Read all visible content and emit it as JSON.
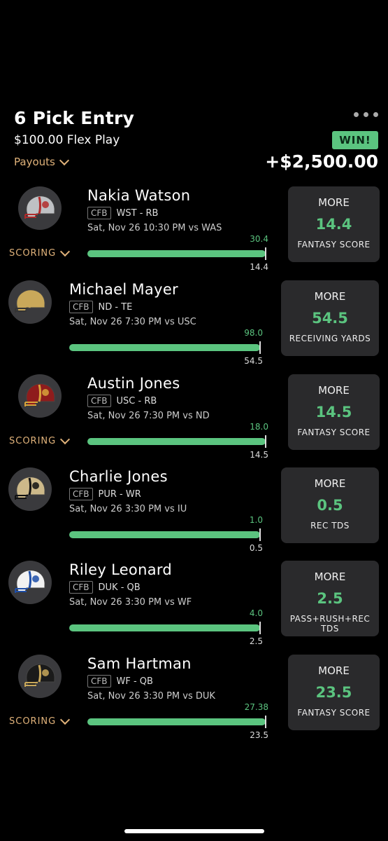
{
  "header": {
    "title": "6 Pick Entry",
    "subtitle": "$100.00 Flex Play",
    "payouts_label": "Payouts",
    "result_badge": "WIN!",
    "payout_amount": "+$2,500.00"
  },
  "colors": {
    "accent_green": "#5bc47f",
    "accent_gold": "#e0b27a",
    "card_bg": "#2a2a2c"
  },
  "scoring_label": "SCORING",
  "picks": [
    {
      "name": "Nakia Watson",
      "league": "CFB",
      "team_pos": "WST - RB",
      "game": "Sat, Nov 26 10:30 PM  vs WAS",
      "actual": "30.4",
      "line": "14.4",
      "direction": "MORE",
      "stat": "FANTASY SCORE",
      "helmet_color": "#bfc1c4",
      "helmet_stripe": "#b22a2a"
    },
    {
      "name": "Michael Mayer",
      "league": "CFB",
      "team_pos": "ND - TE",
      "game": "Sat, Nov 26 7:30 PM  vs USC",
      "actual": "98.0",
      "line": "54.5",
      "direction": "MORE",
      "stat": "RECEIVING YARDS",
      "helmet_color": "#c9a85a",
      "helmet_stripe": "#c9a85a"
    },
    {
      "name": "Austin Jones",
      "league": "CFB",
      "team_pos": "USC - RB",
      "game": "Sat, Nov 26 7:30 PM  vs ND",
      "actual": "18.0",
      "line": "14.5",
      "direction": "MORE",
      "stat": "FANTASY SCORE",
      "helmet_color": "#8e1c1c",
      "helmet_stripe": "#d8a33a"
    },
    {
      "name": "Charlie Jones",
      "league": "CFB",
      "team_pos": "PUR - WR",
      "game": "Sat, Nov 26 3:30 PM  vs IU",
      "actual": "1.0",
      "line": "0.5",
      "direction": "MORE",
      "stat": "REC TDS",
      "helmet_color": "#cdb98a",
      "helmet_stripe": "#111111"
    },
    {
      "name": "Riley Leonard",
      "league": "CFB",
      "team_pos": "DUK - QB",
      "game": "Sat, Nov 26 3:30 PM  vs WF",
      "actual": "4.0",
      "line": "2.5",
      "direction": "MORE",
      "stat": "PASS+RUSH+REC TDS",
      "helmet_color": "#f2f2f2",
      "helmet_stripe": "#1f4fa8"
    },
    {
      "name": "Sam Hartman",
      "league": "CFB",
      "team_pos": "WF - QB",
      "game": "Sat, Nov 26 3:30 PM  vs DUK",
      "actual": "27.38",
      "line": "23.5",
      "direction": "MORE",
      "stat": "FANTASY SCORE",
      "helmet_color": "#1a1a1a",
      "helmet_stripe": "#c9a85a"
    }
  ]
}
